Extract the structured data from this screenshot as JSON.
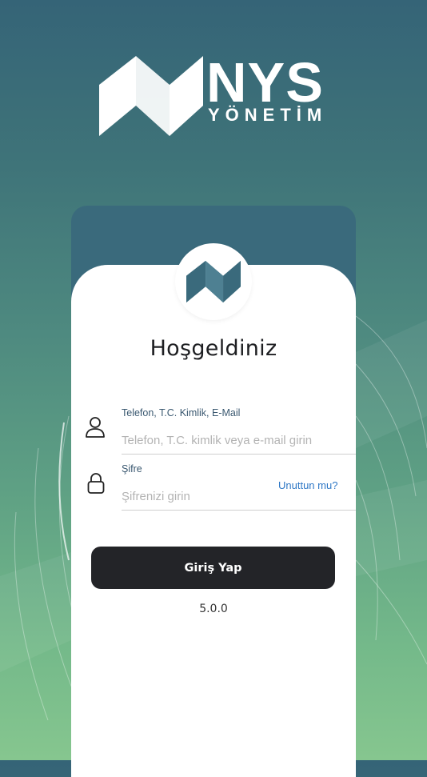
{
  "brand": {
    "title": "NYS",
    "subtitle": "YÖNETİM",
    "logo_icon": "nys-logo-mark-icon"
  },
  "login": {
    "welcome": "Hoşgeldiniz",
    "username": {
      "label": "Telefon, T.C. Kimlik, E-Mail",
      "placeholder": "Telefon, T.C. kimlik veya e-mail girin",
      "value": "",
      "icon": "user-icon"
    },
    "password": {
      "label": "Şifre",
      "placeholder": "Şifrenizi girin",
      "value": "",
      "icon": "lock-icon"
    },
    "forgot_label": "Unuttun mu?",
    "submit_label": "Giriş Yap",
    "version": "5.0.0"
  },
  "colors": {
    "header_band": "#3a6a7c",
    "button": "#232428",
    "link": "#2f78c6",
    "label": "#3a5870"
  }
}
